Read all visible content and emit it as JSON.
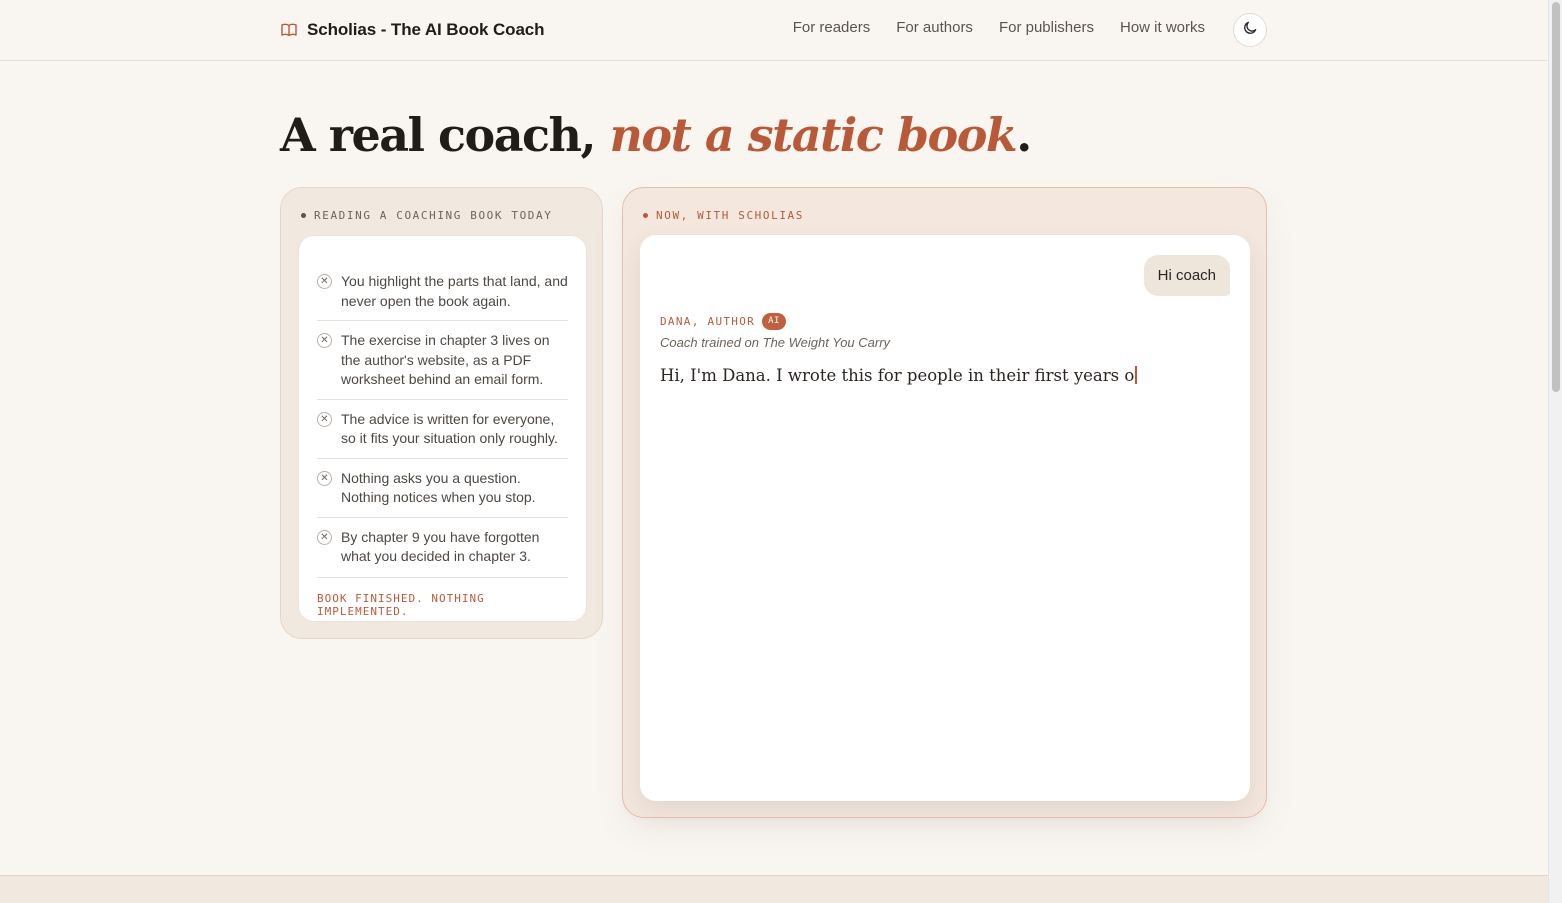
{
  "header": {
    "brand_title": "Scholias - The AI Book Coach",
    "logo_icon": "book-open-icon",
    "nav": [
      "For readers",
      "For authors",
      "For publishers",
      "How it works"
    ],
    "theme_icon": "moon-icon"
  },
  "hero": {
    "headline_plain": "A real coach, ",
    "headline_accent": "not a static book",
    "headline_end": "."
  },
  "left_card": {
    "eyebrow": "READING A COACHING BOOK TODAY",
    "items": [
      "You highlight the parts that land, and never open the book again.",
      "The exercise in chapter 3 lives on the author's website, as a PDF worksheet behind an email form.",
      "The advice is written for everyone, so it fits your situation only roughly.",
      "Nothing asks you a question. Nothing notices when you stop.",
      "By chapter 9 you have forgotten what you decided in chapter 3."
    ],
    "item_icon": "x-circle-icon",
    "footer": "BOOK FINISHED. NOTHING IMPLEMENTED."
  },
  "right_card": {
    "eyebrow": "NOW, WITH SCHOLIAS",
    "user_message": "Hi coach",
    "coach_name": "DANA, AUTHOR",
    "coach_badge": "AI",
    "coach_subtitle": "Coach trained on The Weight You Carry",
    "coach_message": "Hi, I'm Dana. I wrote this for people in their first years o"
  },
  "colors": {
    "accent": "#b85a3a",
    "background": "#f9f6f1",
    "card": "#f1e9e0"
  }
}
